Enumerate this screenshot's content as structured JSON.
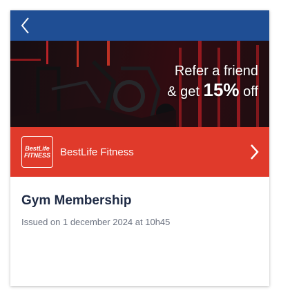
{
  "header": {
    "back_icon": "chevron-left-icon"
  },
  "banner": {
    "line1": "Refer a friend",
    "line2_prefix": "& get ",
    "line2_highlight": "15%",
    "line2_suffix": " off"
  },
  "brand": {
    "logo_line1": "BestLife",
    "logo_line2": "FITNESS",
    "name": "BestLife Fitness",
    "chevron_icon": "chevron-right-icon"
  },
  "membership": {
    "title": "Gym Membership",
    "issued": "Issued on 1 december 2024 at 10h45"
  },
  "colors": {
    "header_blue": "#1f4e94",
    "brand_red": "#e03a2b"
  }
}
